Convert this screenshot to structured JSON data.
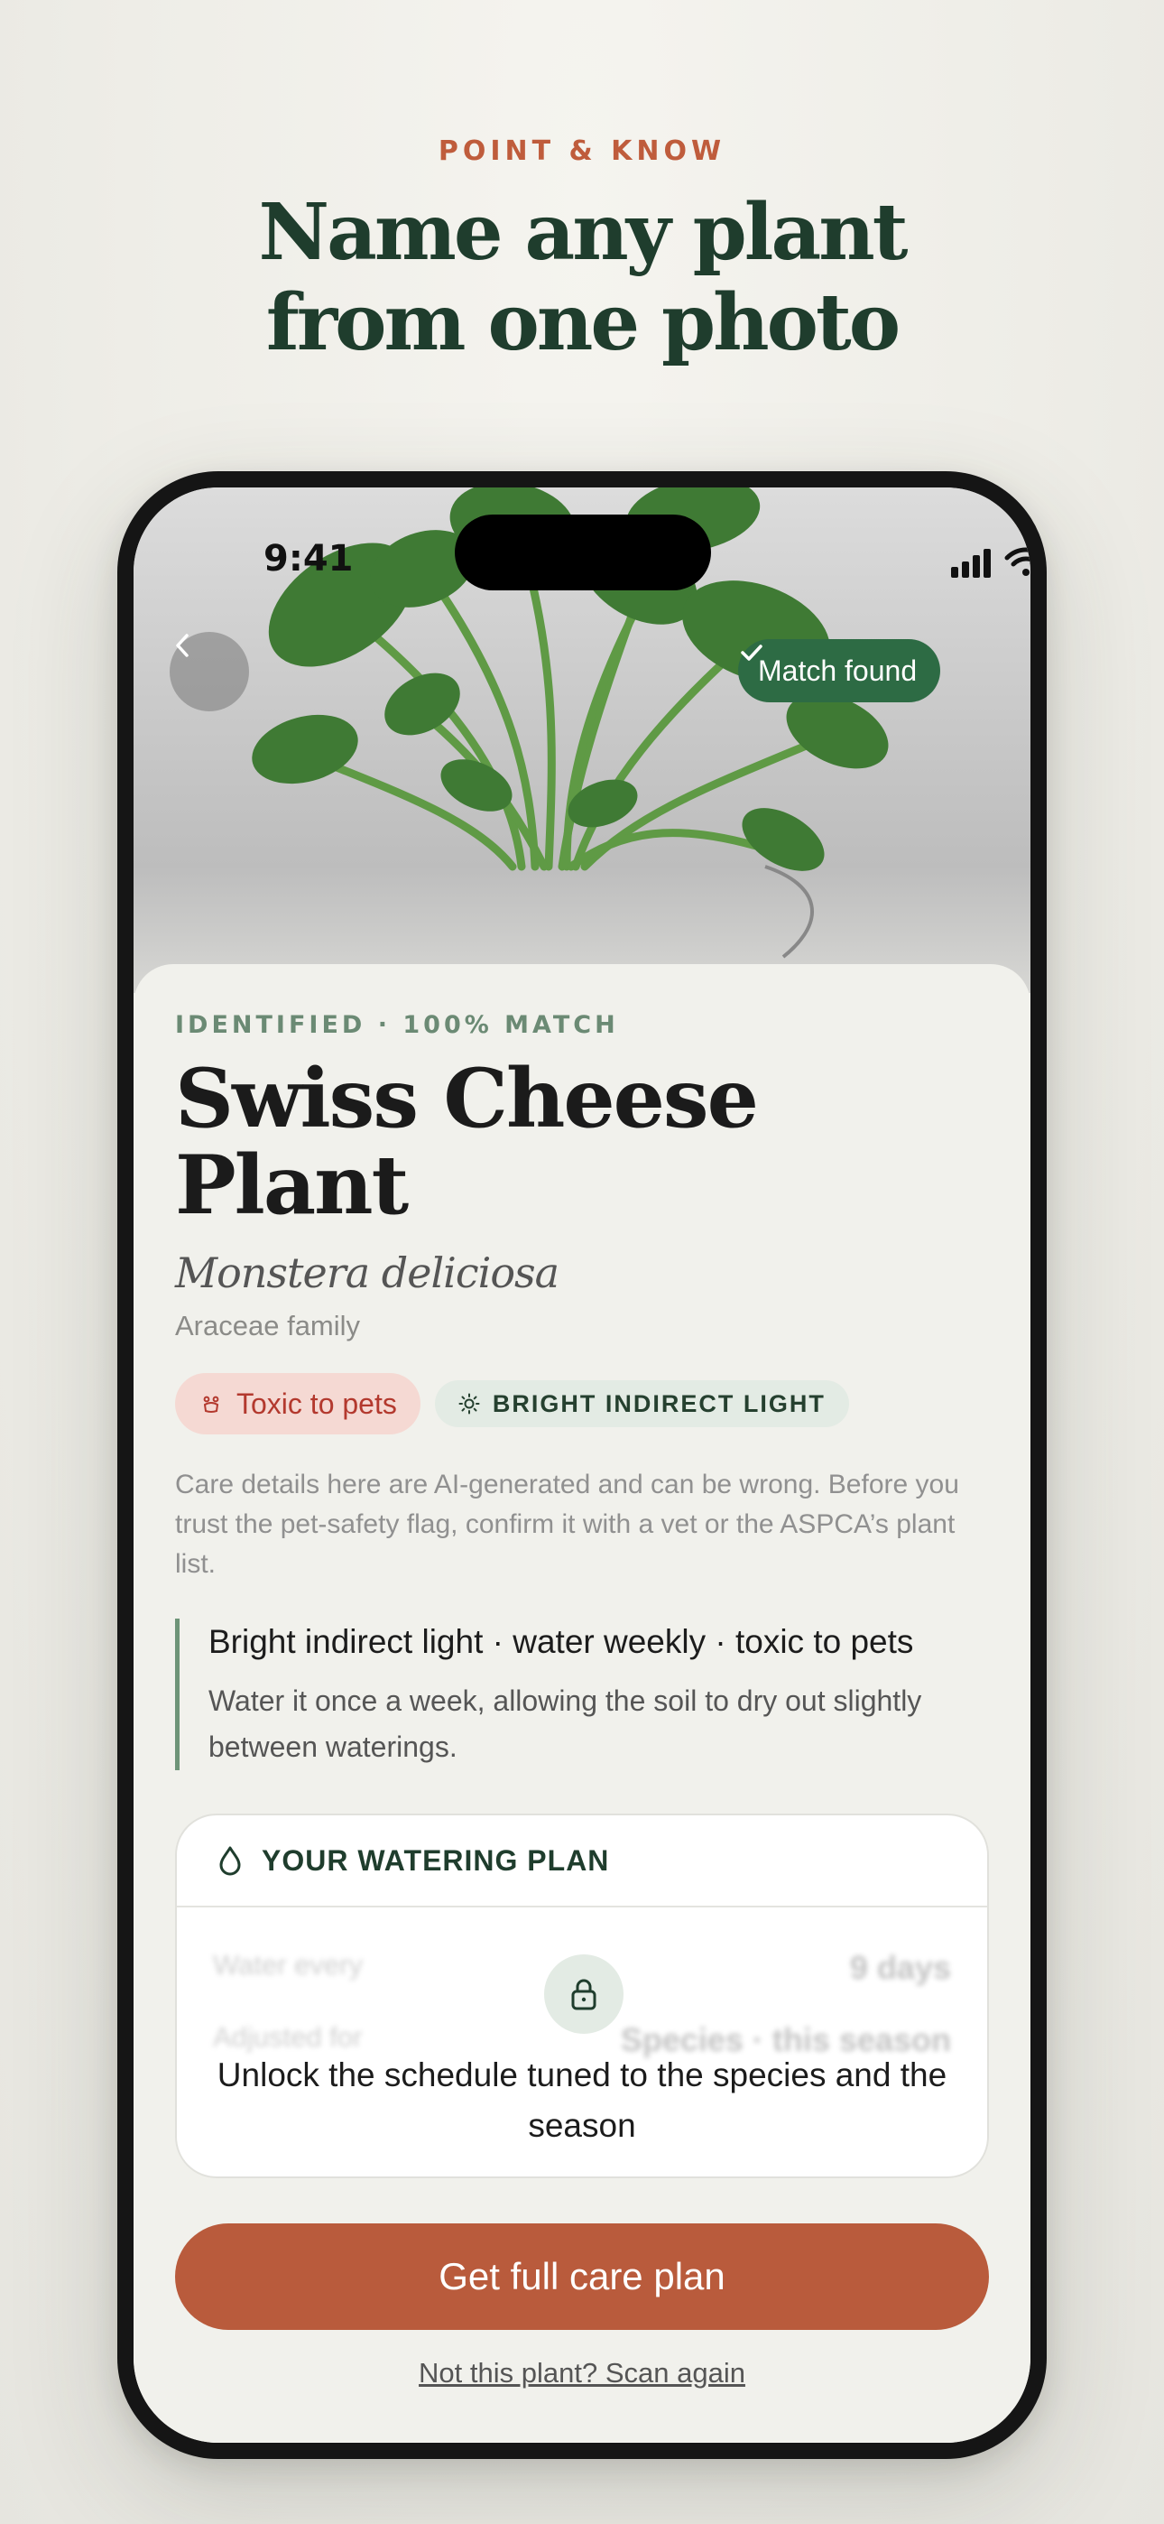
{
  "marketing": {
    "eyebrow": "POINT & KNOW",
    "headline_line1": "Name any plant",
    "headline_line2": "from one photo"
  },
  "status_bar": {
    "time": "9:41"
  },
  "hero": {
    "match_label": "Match found",
    "icons": {
      "back": "chevron-left-icon",
      "match": "checkmark-icon"
    }
  },
  "plant": {
    "overline": "IDENTIFIED · 100% MATCH",
    "common_name": "Swiss Cheese Plant",
    "latin_name": "Monstera deliciosa",
    "family": "Araceae family"
  },
  "chips": {
    "toxic": "Toxic to pets",
    "light": "BRIGHT INDIRECT LIGHT"
  },
  "disclaimer": "Care details here are AI-generated and can be wrong. Before you trust the pet-safety flag, confirm it with a vet or the ASPCA’s plant list.",
  "summary": {
    "title": "Bright indirect light · water weekly · toxic to pets",
    "body": "Water it once a week, allowing the soil to dry out slightly between waterings."
  },
  "watering_plan": {
    "title": "YOUR WATERING PLAN",
    "blurred_rows": [
      {
        "label": "Water every",
        "value": "9 days"
      },
      {
        "label": "Adjusted for",
        "value": "Species · this season"
      }
    ],
    "unlock_text": "Unlock the schedule tuned to the species and the season"
  },
  "actions": {
    "cta": "Get full care plan",
    "rescan": "Not this plant? Scan again"
  },
  "colors": {
    "accent_green": "#2d6b44",
    "cta_terracotta": "#b95b3c",
    "toxic_red": "#b3392e"
  }
}
